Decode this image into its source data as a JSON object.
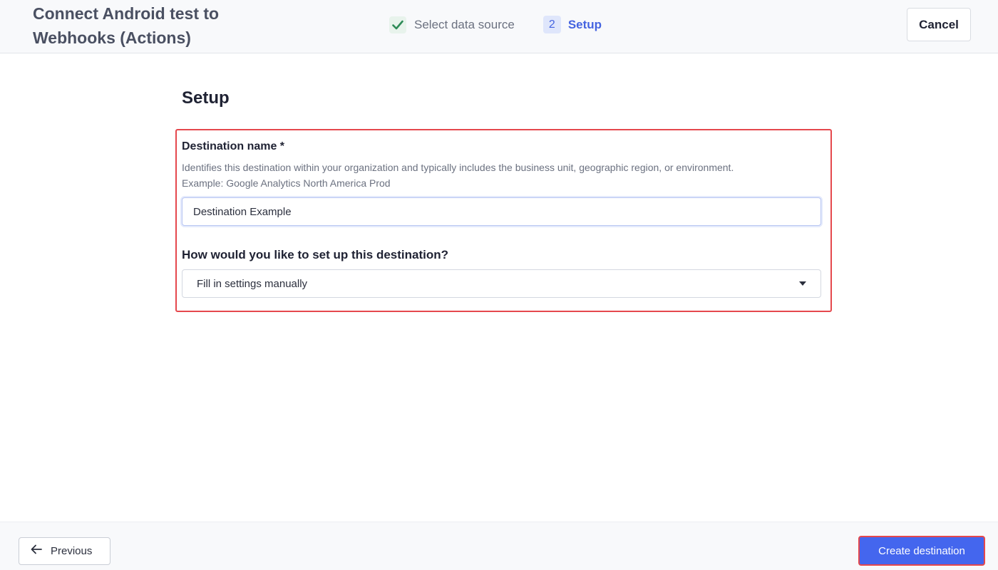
{
  "header": {
    "title": "Connect Android test to Webhooks (Actions)",
    "steps": [
      {
        "label": "Select data source",
        "state": "complete",
        "badge_icon": "check-icon"
      },
      {
        "number": "2",
        "label": "Setup",
        "state": "active"
      }
    ],
    "cancel_label": "Cancel"
  },
  "main": {
    "title": "Setup",
    "destination_name": {
      "label": "Destination name *",
      "help_line1": "Identifies this destination within your organization and typically includes the business unit, geographic region, or environment.",
      "help_line2": "Example: Google Analytics North America Prod",
      "value": "Destination Example"
    },
    "setup_method": {
      "label": "How would you like to set up this destination?",
      "selected": "Fill in settings manually"
    }
  },
  "footer": {
    "previous_label": "Previous",
    "create_label": "Create destination"
  },
  "colors": {
    "accent": "#4466ee",
    "highlight": "#e5484d",
    "success": "#2e8b57"
  }
}
